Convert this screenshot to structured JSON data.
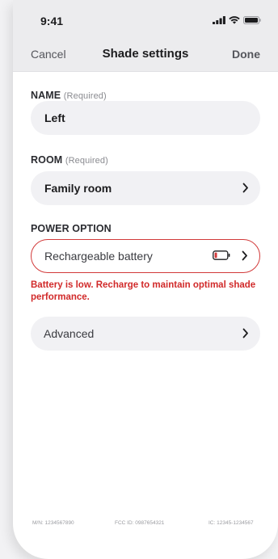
{
  "status_bar": {
    "time": "9:41"
  },
  "nav": {
    "cancel_label": "Cancel",
    "title": "Shade settings",
    "done_label": "Done"
  },
  "name_section": {
    "label": "NAME",
    "required": "(Required)",
    "value": "Left"
  },
  "room_section": {
    "label": "ROOM",
    "required": "(Required)",
    "value": "Family room"
  },
  "power_section": {
    "label": "POWER OPTION",
    "value": "Rechargeable battery",
    "battery_level": 0.2,
    "warning": "Battery is low. Recharge to maintain optimal shade performance."
  },
  "advanced": {
    "label": "Advanced"
  },
  "footer": {
    "model_number": "M/N: 1234567890",
    "fcc_id": "FCC ID: 0987654321",
    "ic": "IC: 12345-1234567"
  },
  "colors": {
    "alert": "#d23a3a",
    "field_bg": "#f1f1f4",
    "header_bg": "#ececee"
  },
  "icons": {
    "signal": "cellular-signal-icon",
    "wifi": "wifi-icon",
    "battery_status": "battery-status-icon",
    "chevron": "chevron-right-icon",
    "low_battery": "low-battery-icon"
  }
}
